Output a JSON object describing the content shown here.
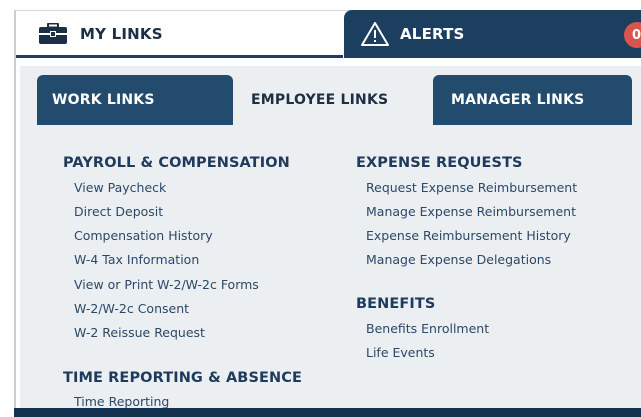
{
  "top_tabs": {
    "my_links": {
      "label": "MY LINKS",
      "icon": "briefcase-icon"
    },
    "alerts": {
      "label": "ALERTS",
      "icon": "warning-icon",
      "badge": "0"
    }
  },
  "sub_tabs": {
    "work": "WORK LINKS",
    "employee": "EMPLOYEE LINKS",
    "manager": "MANAGER LINKS",
    "active": "employee"
  },
  "sections": {
    "payroll": {
      "title": "PAYROLL & COMPENSATION",
      "links": [
        "View Paycheck",
        "Direct Deposit",
        "Compensation History",
        "W-4 Tax Information",
        "View or Print W-2/W-2c Forms",
        "W-2/W-2c Consent",
        "W-2 Reissue Request"
      ]
    },
    "time": {
      "title": "TIME REPORTING & ABSENCE",
      "links": [
        "Time Reporting"
      ]
    },
    "expense": {
      "title": "EXPENSE REQUESTS",
      "links": [
        "Request Expense Reimbursement",
        "Manage Expense Reimbursement",
        "Expense Reimbursement History",
        "Manage Expense Delegations"
      ]
    },
    "benefits": {
      "title": "BENEFITS",
      "links": [
        "Benefits Enrollment",
        "Life Events"
      ]
    }
  },
  "colors": {
    "navy": "#1c3e5f",
    "tab_navy": "#234b6e",
    "content_bg": "#eceff1",
    "link_text": "#2a4868",
    "alert_badge": "#d9534f"
  }
}
